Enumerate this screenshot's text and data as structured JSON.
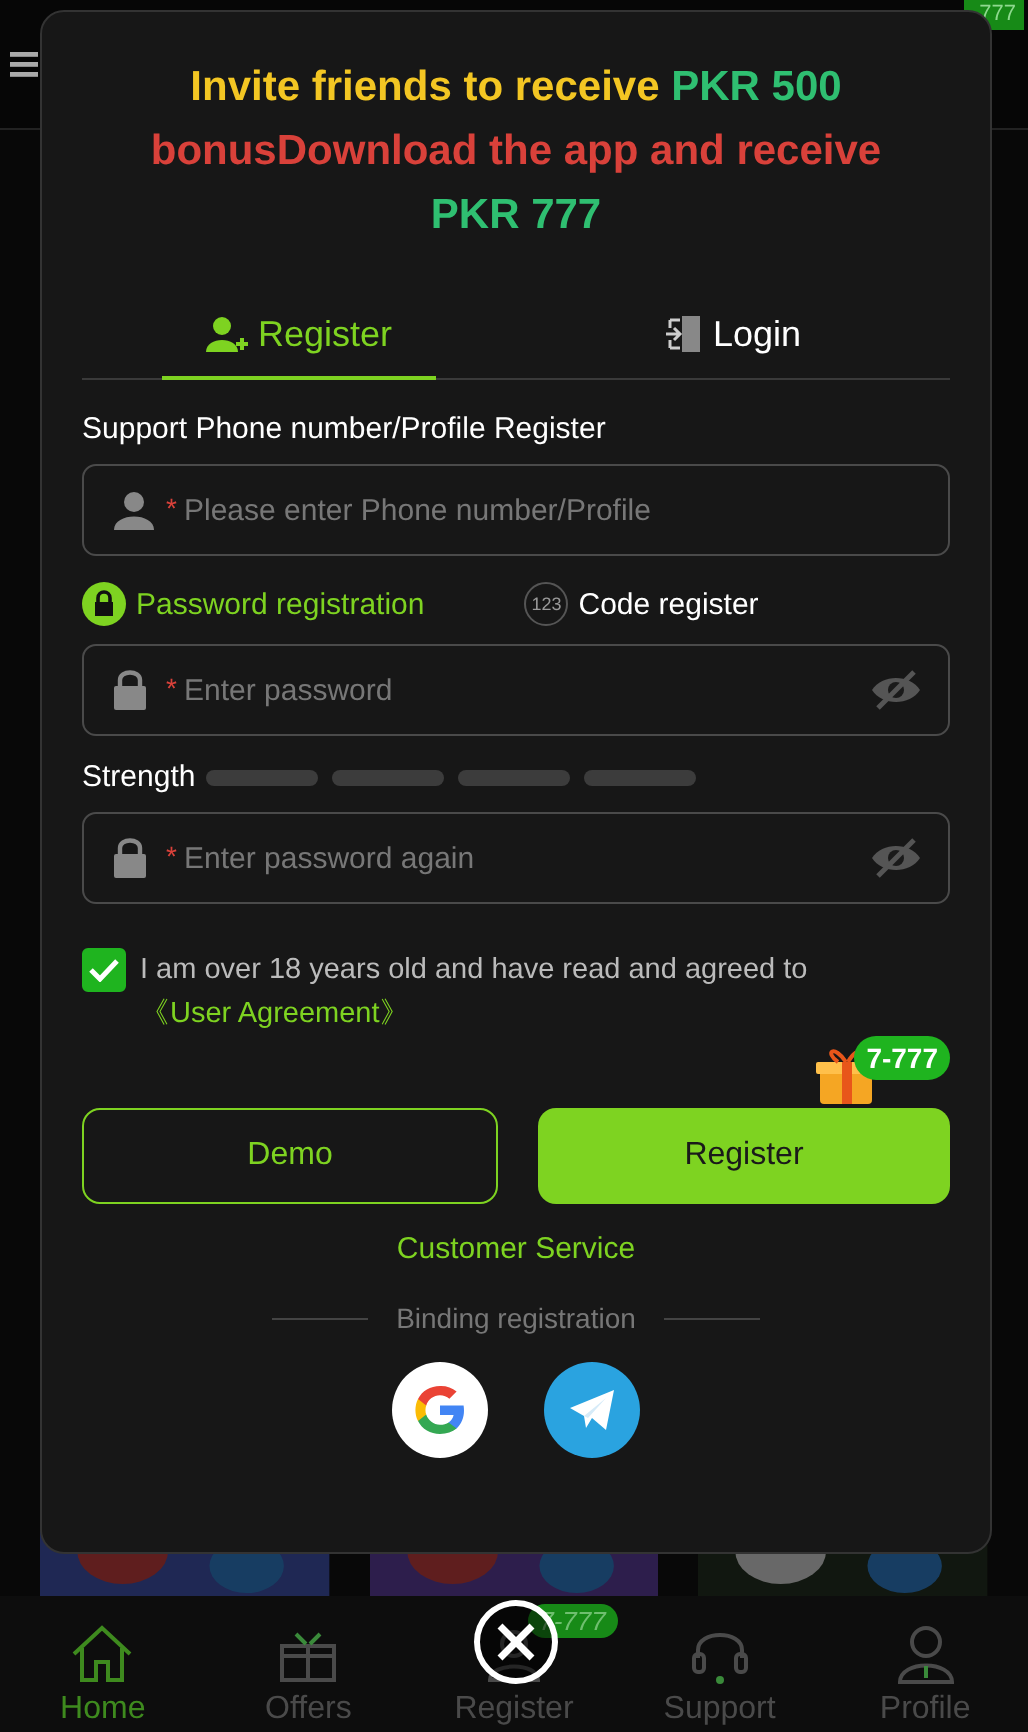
{
  "header": {
    "badge": "777"
  },
  "nav": [
    {
      "label": "Home",
      "selected": true,
      "kind": "home"
    },
    {
      "label": "Offers",
      "selected": false,
      "kind": "gift"
    },
    {
      "label": "Register",
      "selected": false,
      "kind": "register",
      "badge": "7-777"
    },
    {
      "label": "Support",
      "selected": false,
      "kind": "support"
    },
    {
      "label": "Profile",
      "selected": false,
      "kind": "profile"
    }
  ],
  "modal": {
    "headline": [
      {
        "text": "Invite friends to receive ",
        "kind": "invite"
      },
      {
        "text": "PKR 500",
        "kind": "amount"
      },
      {
        "text": " bonusDownload the app and receive ",
        "kind": "notice"
      },
      {
        "text": "PKR 777",
        "kind": "amount"
      }
    ],
    "tabs": [
      {
        "label": "Register",
        "selected": true,
        "kind": "register"
      },
      {
        "label": "Login",
        "selected": false,
        "kind": "login"
      }
    ],
    "account_label": "Support Phone number/Profile Register",
    "account_field": {
      "required": "*",
      "placeholder": "Please enter Phone number/Profile"
    },
    "modes": [
      {
        "label": "Password registration",
        "selected": true,
        "kind": "password"
      },
      {
        "label": "Code register",
        "selected": false,
        "kind": "code",
        "icon_text": "123"
      }
    ],
    "password_field": {
      "required": "*",
      "placeholder": "Enter password"
    },
    "strength": {
      "label": "Strength"
    },
    "confirm_field": {
      "required": "*",
      "placeholder": "Enter password again"
    },
    "agreement": {
      "checked": true,
      "text": "I am over 18 years old and have read and agreed to ",
      "link": "《User Agreement》"
    },
    "promo_badge": "7-777",
    "buttons": [
      {
        "label": "Demo",
        "kind": "outline"
      },
      {
        "label": "Register",
        "kind": "primary"
      }
    ],
    "service_link": "Customer Service",
    "binding_label": "Binding registration",
    "social": [
      {
        "kind": "google"
      },
      {
        "kind": "telegram"
      }
    ]
  }
}
